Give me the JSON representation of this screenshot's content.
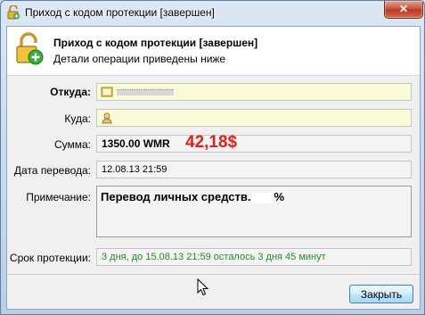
{
  "window": {
    "title": "Приход с кодом протекции [завершен]",
    "close_label": "✕"
  },
  "header": {
    "title": "Приход с кодом протекции [завершен]",
    "subtitle": "Детали операции приведены ниже"
  },
  "fields": {
    "from_label": "Откуда:",
    "to_label": "Куда:",
    "amount_label": "Сумма:",
    "amount_value": "1350.00 WMR",
    "amount_annotation": "42,18$",
    "date_label": "Дата перевода:",
    "date_value": "12.08.13 21:59",
    "note_label": "Примечание:",
    "note_value_start": "Перевод личных средств.",
    "note_value_end": "%",
    "protection_label": "Срок протекции:",
    "protection_value": "3 дня, до 15.08.13 21:59 осталось 3 дня 45 минут"
  },
  "buttons": {
    "close_label": "Закрыть"
  },
  "icons": {
    "window": "lock-open-icon",
    "header": "lock-open-add-icon",
    "from": "wallet-icon",
    "to": "contact-icon",
    "cursor": "mouse-cursor-icon"
  },
  "colors": {
    "annotation": "#e0201a",
    "protection_text": "#228b22",
    "highlight_field": "#fbfbd8"
  }
}
